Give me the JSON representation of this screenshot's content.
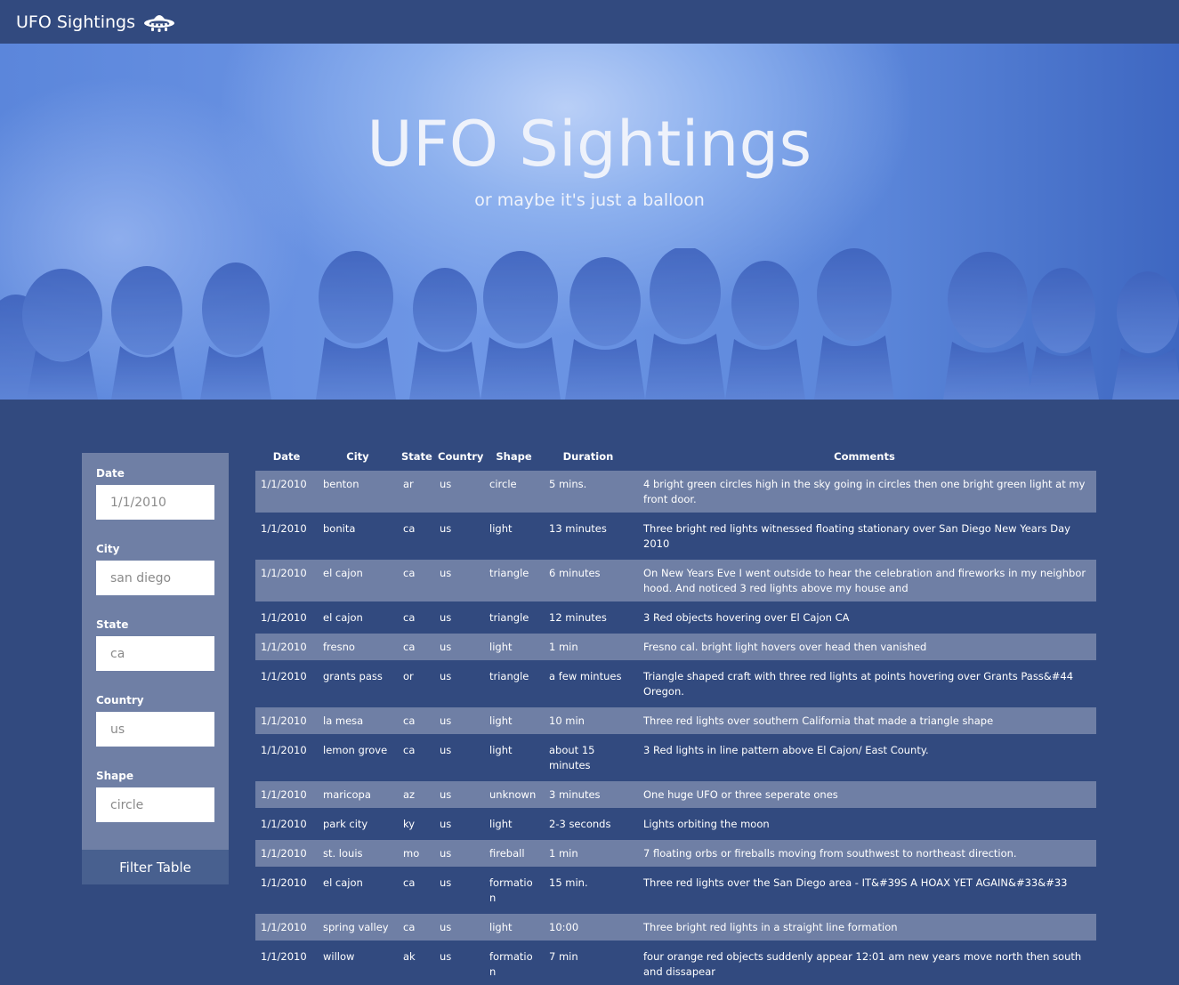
{
  "navbar": {
    "brand": "UFO Sightings",
    "icon": "ufo-icon"
  },
  "hero": {
    "title": "UFO Sightings",
    "subtitle": "or maybe it's just a balloon"
  },
  "filters": {
    "date": {
      "label": "Date",
      "placeholder": "1/1/2010"
    },
    "city": {
      "label": "City",
      "placeholder": "san diego"
    },
    "state": {
      "label": "State",
      "placeholder": "ca"
    },
    "country": {
      "label": "Country",
      "placeholder": "us"
    },
    "shape": {
      "label": "Shape",
      "placeholder": "circle"
    },
    "button": "Filter Table"
  },
  "table": {
    "headers": [
      "Date",
      "City",
      "State",
      "Country",
      "Shape",
      "Duration",
      "Comments"
    ],
    "rows": [
      [
        "1/1/2010",
        "benton",
        "ar",
        "us",
        "circle",
        "5 mins.",
        "4 bright green circles high in the sky going in circles then one bright green light at my front door."
      ],
      [
        "1/1/2010",
        "bonita",
        "ca",
        "us",
        "light",
        "13 minutes",
        "Three bright red lights witnessed floating stationary over San Diego New Years Day 2010"
      ],
      [
        "1/1/2010",
        "el cajon",
        "ca",
        "us",
        "triangle",
        "6 minutes",
        "On New Years Eve I went outside to hear the celebration and fireworks in my neighbor hood. And noticed 3 red lights above my house and"
      ],
      [
        "1/1/2010",
        "el cajon",
        "ca",
        "us",
        "triangle",
        "12 minutes",
        "3 Red objects hovering over El Cajon CA"
      ],
      [
        "1/1/2010",
        "fresno",
        "ca",
        "us",
        "light",
        "1 min",
        "Fresno cal. bright light hovers over head then vanished"
      ],
      [
        "1/1/2010",
        "grants pass",
        "or",
        "us",
        "triangle",
        "a few mintues",
        "Triangle shaped craft with three red lights at points hovering over Grants Pass&#44 Oregon."
      ],
      [
        "1/1/2010",
        "la mesa",
        "ca",
        "us",
        "light",
        "10 min",
        "Three red lights over southern California that made a triangle shape"
      ],
      [
        "1/1/2010",
        "lemon grove",
        "ca",
        "us",
        "light",
        "about 15 minutes",
        "3 Red lights in line pattern above El Cajon/ East County."
      ],
      [
        "1/1/2010",
        "maricopa",
        "az",
        "us",
        "unknown",
        "3 minutes",
        "One huge UFO or three seperate ones"
      ],
      [
        "1/1/2010",
        "park city",
        "ky",
        "us",
        "light",
        "2-3 seconds",
        "Lights orbiting the moon"
      ],
      [
        "1/1/2010",
        "st. louis",
        "mo",
        "us",
        "fireball",
        "1 min",
        "7 floating orbs or fireballs moving from southwest to northeast direction."
      ],
      [
        "1/1/2010",
        "el cajon",
        "ca",
        "us",
        "formation",
        "15 min.",
        "Three red lights over the San Diego area - IT&#39S A HOAX YET AGAIN&#33&#33"
      ],
      [
        "1/1/2010",
        "spring valley",
        "ca",
        "us",
        "light",
        "10:00",
        "Three bright red lights in a straight line formation"
      ],
      [
        "1/1/2010",
        "willow",
        "ak",
        "us",
        "formation",
        "7 min",
        "four orange red objects suddenly appear 12:01 am new years move north then south and dissapear"
      ]
    ]
  }
}
